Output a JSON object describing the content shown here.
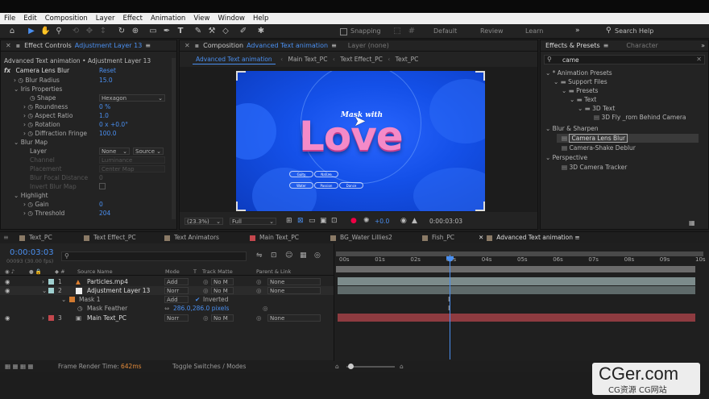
{
  "menu": [
    "File",
    "Edit",
    "Composition",
    "Layer",
    "Effect",
    "Animation",
    "View",
    "Window",
    "Help"
  ],
  "toolbar": {
    "snapping_label": "Snapping",
    "workspaces": [
      "Default",
      "Review",
      "Learn"
    ],
    "search_help": "Search Help"
  },
  "effect_controls": {
    "tab_label": "Effect Controls",
    "tab_layer": "Adjustment Layer 13",
    "subtitle": "Advanced Text animation • Adjustment Layer 13",
    "effect_name": "Camera Lens Blur",
    "reset_label": "Reset",
    "props": [
      {
        "label": "Blur Radius",
        "value": "15.0"
      },
      {
        "label": "Iris Properties",
        "value": ""
      },
      {
        "label": "Shape",
        "value": "Hexagon"
      },
      {
        "label": "Roundness",
        "value": "0 %"
      },
      {
        "label": "Aspect Ratio",
        "value": "1.0"
      },
      {
        "label": "Rotation",
        "value": "0 x +0.0°"
      },
      {
        "label": "Diffraction Fringe",
        "value": "100.0"
      },
      {
        "label": "Blur Map",
        "value": ""
      },
      {
        "label": "Layer",
        "value": "None"
      },
      {
        "label": "Channel",
        "value": "Luminance"
      },
      {
        "label": "Placement",
        "value": "Center Map"
      },
      {
        "label": "Blur Focal Distance",
        "value": "0"
      },
      {
        "label": "Invert Blur Map",
        "value": ""
      },
      {
        "label": "Highlight",
        "value": ""
      },
      {
        "label": "Gain",
        "value": "0"
      },
      {
        "label": "Threshold",
        "value": "204"
      }
    ],
    "source_label": "Source"
  },
  "composition": {
    "tab_label": "Composition",
    "tab_comp": "Advanced Text animation",
    "layer_tab": "Layer  (none)",
    "crumbs": [
      "Advanced Text animation",
      "Main Text_PC",
      "Text Effect_PC",
      "Text_PC"
    ],
    "canvas_small_text": "Mask with",
    "canvas_big_text": "Love",
    "buttons": [
      "Guity",
      "Nature",
      "Water",
      "Passion",
      "Dance"
    ],
    "zoom": "(23.3%)",
    "resolution": "Full",
    "exposure": "+0.0",
    "timecode": "0:00:03:03"
  },
  "effects_presets": {
    "tab_label": "Effects & Presets",
    "tab2": "Character",
    "search_value": "came",
    "tree": [
      {
        "label": "* Animation Presets",
        "indent": 0
      },
      {
        "label": "Support Files",
        "indent": 1
      },
      {
        "label": "Presets",
        "indent": 2
      },
      {
        "label": "Text",
        "indent": 3
      },
      {
        "label": "3D Text",
        "indent": 4
      },
      {
        "label": "3D Fly _rom Behind Camera",
        "indent": 5
      },
      {
        "label": "Blur & Sharpen",
        "indent": 0
      },
      {
        "label": "Camera Lens Blur",
        "indent": 1
      },
      {
        "label": "Camera-Shake Deblur",
        "indent": 1
      },
      {
        "label": "Perspective",
        "indent": 0
      },
      {
        "label": "3D Camera Tracker",
        "indent": 1
      }
    ]
  },
  "timeline": {
    "tabs": [
      {
        "label": "Text_PC",
        "color": "#8a7a66"
      },
      {
        "label": "Text Effect_PC",
        "color": "#8a7a66"
      },
      {
        "label": "Text Animators",
        "color": "#8a7a66"
      },
      {
        "label": "Main Text_PC",
        "color": "#c4474d"
      },
      {
        "label": "BG_Water Lillies2",
        "color": "#8a7a66"
      },
      {
        "label": "Fish_PC",
        "color": "#8a7a66"
      },
      {
        "label": "Advanced Text animation",
        "color": "#8a7a66"
      }
    ],
    "timecode": "0:00:03:03",
    "fps": "00093 (30.00 fps)",
    "col_source": "Source Name",
    "col_mode": "Mode",
    "col_t": "T",
    "col_trkmat": "Track Matte",
    "col_parent": "Parent & Link",
    "layers": [
      {
        "num": "1",
        "name": "Particles.mp4",
        "mode": "Add",
        "matte": "No M",
        "parent": "None",
        "label_color": "#9fcfcf"
      },
      {
        "num": "2",
        "name": "Adjustment Layer 13",
        "mode": "Norr",
        "matte": "No M",
        "parent": "None",
        "label_color": "#9fcfcf"
      },
      {
        "num": "",
        "name": "Mask 1",
        "mode": "Add",
        "matte": "Inverted",
        "parent": "",
        "label_color": ""
      },
      {
        "num": "",
        "name": "Mask Feather",
        "mode": "286.0,286.0 pixels",
        "matte": "",
        "parent": "",
        "label_color": ""
      },
      {
        "num": "3",
        "name": "Main Text_PC",
        "mode": "Norr",
        "matte": "No M",
        "parent": "None",
        "label_color": "#c4474d"
      }
    ],
    "ruler": [
      "00s",
      "01s",
      "02s",
      "03s",
      "04s",
      "05s",
      "06s",
      "07s",
      "08s",
      "09s",
      "10s"
    ],
    "current_time_sec": 3.1,
    "render_time_label": "Frame Render Time:",
    "render_time_value": "642ms",
    "toggle_label": "Toggle Switches / Modes"
  },
  "watermark": {
    "big": "CGer.com",
    "small": "CG资源 CG网站"
  }
}
